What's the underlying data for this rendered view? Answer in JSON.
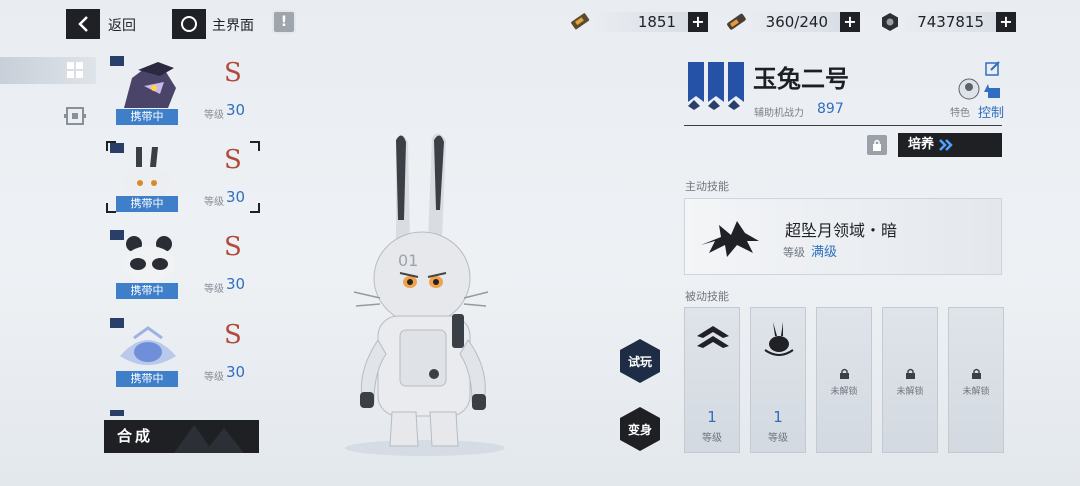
{
  "topbar": {
    "back_label": "返回",
    "home_label": "主界面",
    "info_label": "!"
  },
  "resources": [
    {
      "icon": "ticket-icon",
      "value": "1851"
    },
    {
      "icon": "energy-icon",
      "value": "360/240"
    },
    {
      "icon": "nut-icon",
      "value": "7437815"
    }
  ],
  "sidebar": {
    "cards": [
      {
        "rank": "S",
        "carry": "携带中",
        "level_key": "等级",
        "level": "30"
      },
      {
        "rank": "S",
        "carry": "携带中",
        "level_key": "等级",
        "level": "30"
      },
      {
        "rank": "S",
        "carry": "携带中",
        "level_key": "等级",
        "level": "30"
      },
      {
        "rank": "S",
        "carry": "携带中",
        "level_key": "等级",
        "level": "30"
      }
    ],
    "synth_label": "合成"
  },
  "mech": {
    "name": "玉兔二号",
    "power_key": "辅助机战力",
    "power": "897",
    "trait_key": "特色",
    "trait": "控制",
    "train_label": "培养",
    "model_text": "01"
  },
  "active": {
    "title": "主动技能",
    "skill_name": "超坠月领域・暗",
    "level_key": "等级",
    "level": "满级"
  },
  "passive": {
    "title": "被动技能",
    "slots": [
      {
        "level": "1",
        "level_key": "等级"
      },
      {
        "level": "1",
        "level_key": "等级"
      },
      {
        "locked": "未解锁"
      },
      {
        "locked": "未解锁"
      },
      {
        "locked": "未解锁"
      }
    ]
  },
  "actions": {
    "try_label": "试玩",
    "transform_label": "变身"
  },
  "colors": {
    "accent_blue": "#2f6fbf",
    "rank_red": "#b14a3a",
    "dark": "#1e2024"
  }
}
